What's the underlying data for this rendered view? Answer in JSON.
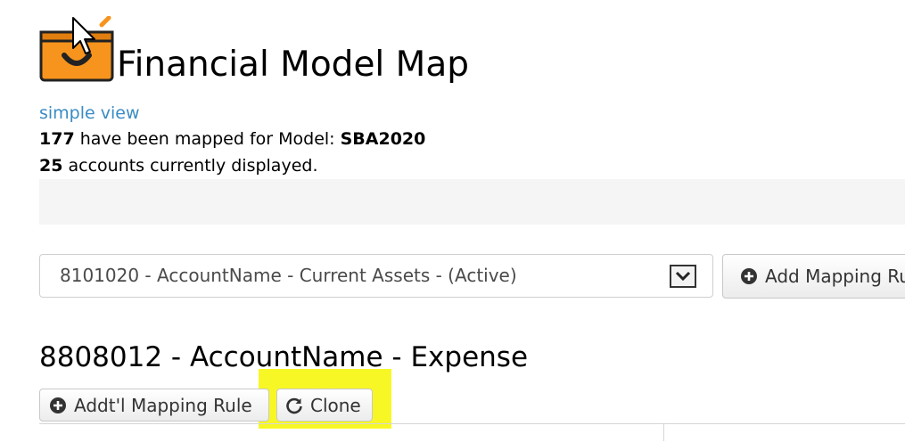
{
  "header": {
    "title": "Financial Model Map",
    "app_icon": "toolbox-smiley-icon"
  },
  "simple_view_link": "simple-view",
  "simple_view_label": "simple view",
  "summary": {
    "mapped_count": "177",
    "mapped_text": " have been mapped for Model: ",
    "model_name": "SBA2020",
    "displayed_count": "25",
    "displayed_text": " accounts currently displayed."
  },
  "account_select": {
    "selected": "8101020 - AccountName - Current Assets - (Active)"
  },
  "buttons": {
    "add_mapping_rule": "Add Mapping Rule",
    "addtl_mapping_rule": "Addt'l Mapping Rule",
    "clone": "Clone"
  },
  "account": {
    "title": "8808012 - AccountName - Expense"
  },
  "colors": {
    "link": "#3a8cc4",
    "highlight": "#f6f600",
    "icon_orange": "#f7941d"
  }
}
